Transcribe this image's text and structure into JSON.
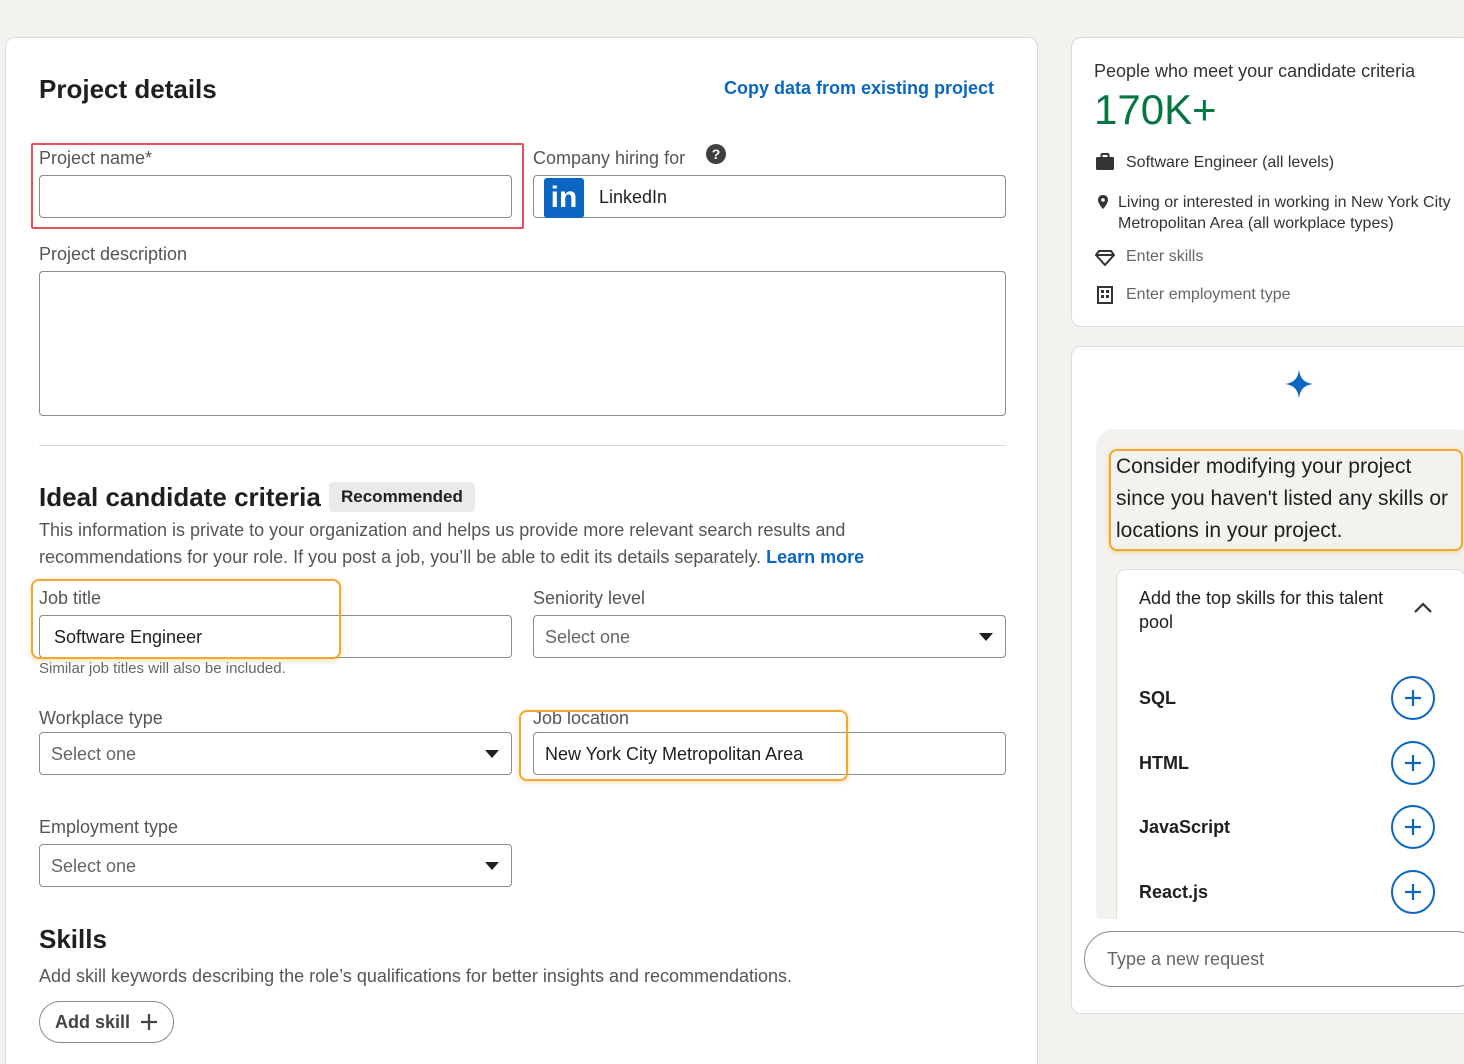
{
  "project": {
    "title": "Project details",
    "copy_link": "Copy data from existing project",
    "name_label": "Project name*",
    "name_value": "",
    "company_label": "Company hiring for",
    "company_value": "LinkedIn",
    "company_logo_text": "in",
    "description_label": "Project description",
    "description_value": ""
  },
  "criteria": {
    "title": "Ideal candidate criteria",
    "badge": "Recommended",
    "info_line1": "This information is private to your organization and helps us provide more relevant search results and",
    "info_line2": "recommendations for your role. If you post a job, you’ll be able to edit its details separately.",
    "learn_more": "Learn more",
    "job_title_label": "Job title",
    "job_title_value": "Software Engineer",
    "job_title_hint": "Similar job titles will also be included.",
    "seniority_label": "Seniority level",
    "seniority_value": "Select one",
    "workplace_label": "Workplace type",
    "workplace_value": "Select one",
    "location_label": "Job location",
    "location_value": "New York City Metropolitan Area",
    "employment_label": "Employment type",
    "employment_value": "Select one"
  },
  "skills": {
    "title": "Skills",
    "desc": "Add skill keywords describing the role’s qualifications for better insights and recommendations.",
    "add_button": "Add skill"
  },
  "sidebar": {
    "heading": "People who meet your candidate criteria",
    "count": "170K+",
    "count_color": "#057642",
    "rows": [
      {
        "icon": "briefcase-icon",
        "text": "Software Engineer (all levels)"
      },
      {
        "icon": "location-pin-icon",
        "text1": "Living or interested in working in New York City",
        "text2": "Metropolitan Area (all workplace types)"
      },
      {
        "icon": "diamond-icon",
        "text": "Enter skills"
      },
      {
        "icon": "building-icon",
        "text": "Enter employment type"
      }
    ]
  },
  "assistant": {
    "message_line1": "Consider modifying your project",
    "message_line2": "since you haven't listed any skills or",
    "message_line3": "locations in your project.",
    "suggest_title_line1": "Add the top skills for this talent",
    "suggest_title_line2": "pool",
    "skills": [
      "SQL",
      "HTML",
      "JavaScript",
      "React.js"
    ],
    "input_placeholder": "Type a new request"
  },
  "colors": {
    "accent": "#0a66c2",
    "highlight_red": "#e3505a",
    "highlight_orange": "#f0a930"
  }
}
